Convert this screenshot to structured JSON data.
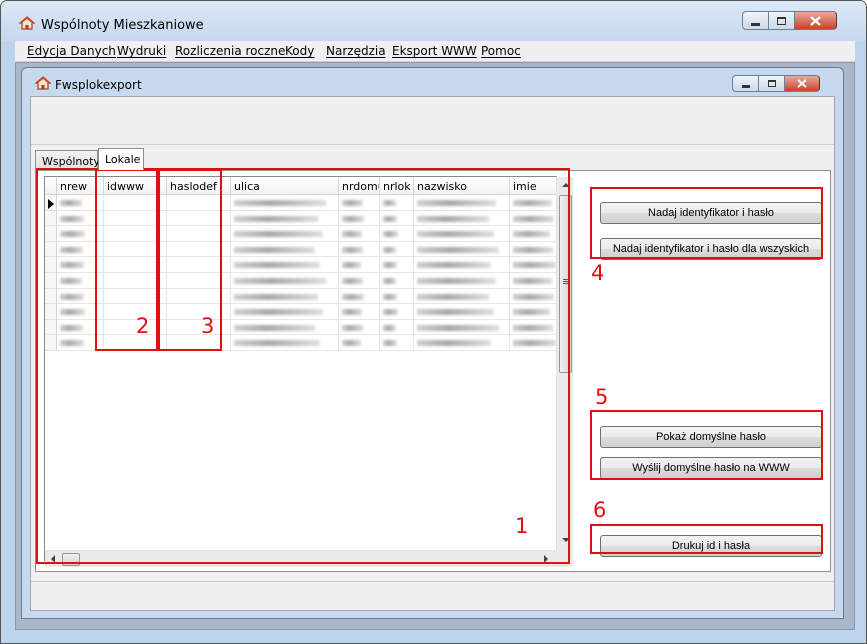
{
  "outer_window": {
    "title": "Wspólnoty Mieszkaniowe"
  },
  "menu": [
    "Edycja Danych",
    "Wydruki",
    "Rozliczenia roczne",
    "Kody",
    "Narzędzia",
    "Eksport WWW",
    "Pomoc"
  ],
  "inner_window": {
    "title": "Fwsplokexport"
  },
  "tabs": [
    {
      "label": "Wspólnoty",
      "active": false
    },
    {
      "label": "Lokale",
      "active": true
    }
  ],
  "grid": {
    "columns": [
      "nrew",
      "idwww",
      "haslodef",
      "ulica",
      "nrdomu",
      "nrlok",
      "nazwisko",
      "imie"
    ],
    "visible_rows": 10,
    "selected_row": 0
  },
  "buttons": {
    "assign_id": "Nadaj identyfikator i hasło",
    "assign_id_all": "Nadaj identyfikator i hasło dla wszyskich",
    "show_default": "Pokaż domyślne hasło",
    "send_default": "Wyślij domyślne hasło na WWW",
    "print_ids": "Drukuj id i hasła"
  },
  "annotations": [
    "1",
    "2",
    "3",
    "4",
    "5",
    "6"
  ],
  "colors": {
    "annotation_red": "#e01010",
    "title_bar": "#c5d8ee",
    "close_button": "#c7432b"
  },
  "icons": [
    "house-icon",
    "minimize-icon",
    "maximize-icon",
    "close-icon"
  ]
}
